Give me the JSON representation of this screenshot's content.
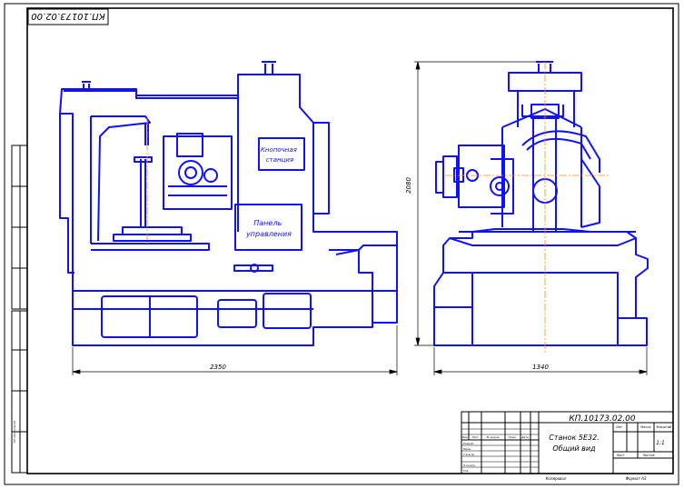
{
  "drawing": {
    "stamp_code": "КП.10173.02.00",
    "side_code": "КП.10173.02.00",
    "labels": {
      "button_station": "Кнопочная станция",
      "control_panel": "Панель управления"
    },
    "dimensions": {
      "width_front": "2350",
      "width_side": "1340",
      "height_side": "2080"
    }
  },
  "title_block": {
    "code": "КП.10173.02.00",
    "title_line1": "Станок 5Е32.",
    "title_line2": "Общий вид",
    "scale": "1:1",
    "sheet_label": "Лист",
    "sheets_label": "Листов",
    "lit_label": "Лит.",
    "mass_label": "Масса",
    "scale_label": "Масштаб",
    "rows": [
      "Разраб.",
      "Пров.",
      "Т.контр.",
      "Н.контр.",
      "Утв."
    ],
    "cols": [
      "Изм.",
      "Лист",
      "№ докум.",
      "Подп.",
      "Дата"
    ],
    "copied": "Копировал",
    "format": "Формат   А3"
  },
  "colors": {
    "line": "#1010ff",
    "frame": "#000000",
    "axis": "#ff8c00"
  }
}
